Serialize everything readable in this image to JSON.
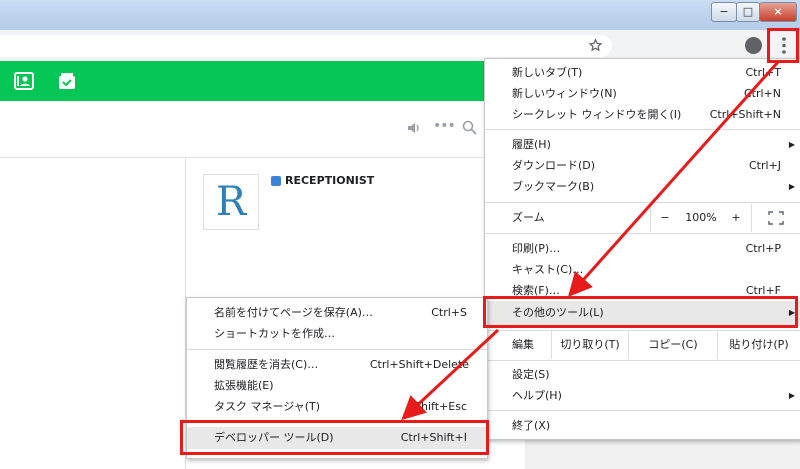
{
  "window": {
    "minimize": "−",
    "maximize": "□",
    "close": "×"
  },
  "icons": {
    "star": "star-icon",
    "profile": "profile-icon",
    "kebab": "kebab-menu-icon"
  },
  "app": {
    "name": "RECEPTIONIST",
    "logo_letter": "R",
    "colors": {
      "accent": "#06c755",
      "annotation": "#e81a1a"
    }
  },
  "chrome_menu": {
    "new_tab": {
      "label": "新しいタブ(T)",
      "shortcut": "Ctrl+T"
    },
    "new_window": {
      "label": "新しいウィンドウ(N)",
      "shortcut": "Ctrl+N"
    },
    "incognito": {
      "label": "シークレット ウィンドウを開く(I)",
      "shortcut": "Ctrl+Shift+N"
    },
    "history": {
      "label": "履歴(H)"
    },
    "downloads": {
      "label": "ダウンロード(D)",
      "shortcut": "Ctrl+J"
    },
    "bookmarks": {
      "label": "ブックマーク(B)"
    },
    "zoom": {
      "label": "ズーム",
      "minus": "−",
      "value": "100%",
      "plus": "+"
    },
    "print": {
      "label": "印刷(P)…",
      "shortcut": "Ctrl+P"
    },
    "cast": {
      "label": "キャスト(C)…"
    },
    "find": {
      "label": "検索(F)…",
      "shortcut": "Ctrl+F"
    },
    "more_tools": {
      "label": "その他のツール(L)"
    },
    "edit": {
      "label": "編集",
      "cut": "切り取り(T)",
      "copy": "コピー(C)",
      "paste": "貼り付け(P)"
    },
    "settings": {
      "label": "設定(S)"
    },
    "help": {
      "label": "ヘルプ(H)"
    },
    "exit": {
      "label": "終了(X)"
    }
  },
  "submenu": {
    "save_page": {
      "label": "名前を付けてページを保存(A)…",
      "shortcut": "Ctrl+S"
    },
    "create_shortcut": {
      "label": "ショートカットを作成…"
    },
    "clear_data": {
      "label": "閲覧履歴を消去(C)…",
      "shortcut": "Ctrl+Shift+Delete"
    },
    "extensions": {
      "label": "拡張機能(E)"
    },
    "task_manager": {
      "label": "タスク マネージャ(T)",
      "shortcut": "Shift+Esc"
    },
    "devtools": {
      "label": "デベロッパー ツール(D)",
      "shortcut": "Ctrl+Shift+I"
    }
  }
}
